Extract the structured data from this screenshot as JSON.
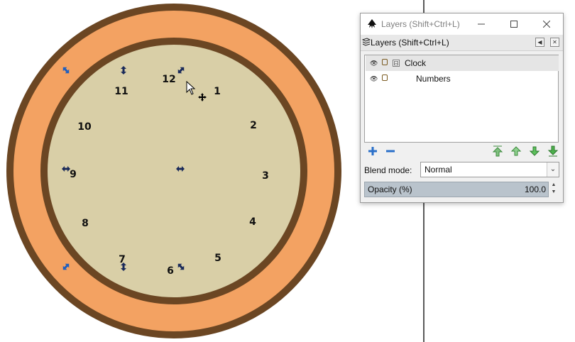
{
  "canvas": {
    "clock_numbers": [
      "12",
      "1",
      "2",
      "3",
      "4",
      "5",
      "6",
      "7",
      "8",
      "9",
      "10",
      "11"
    ],
    "colors": {
      "outer_ring": "#f3a262",
      "ring_border": "#6b4623",
      "face": "#d9cfa7",
      "background": "#ffffff"
    }
  },
  "window": {
    "title": "Layers (Shift+Ctrl+L)",
    "minimize_icon": "minimize-icon",
    "maximize_icon": "maximize-icon",
    "close_icon": "close-icon"
  },
  "dock": {
    "title": "Layers (Shift+Ctrl+L)",
    "buttons": [
      "collapse",
      "close"
    ]
  },
  "layers": [
    {
      "name": "Clock",
      "visible": true,
      "locked": false,
      "expanded": true,
      "selected": true,
      "expander": "⊟"
    },
    {
      "name": "Numbers",
      "visible": true,
      "locked": false,
      "selected": false
    }
  ],
  "toolbar": {
    "icons": [
      "add-layer-icon",
      "remove-layer-icon",
      "raise-to-top-icon",
      "raise-icon",
      "lower-icon",
      "lower-to-bottom-icon"
    ]
  },
  "blend": {
    "label": "Blend mode:",
    "value": "Normal"
  },
  "opacity": {
    "label": "Opacity (%)",
    "value": "100.0"
  }
}
